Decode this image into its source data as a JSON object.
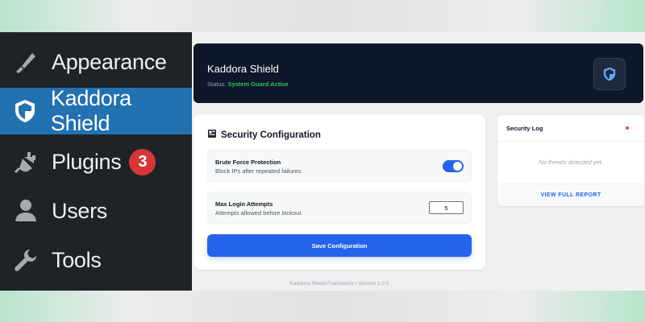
{
  "sidebar": {
    "items": [
      {
        "label": "Appearance",
        "icon": "paintbrush-icon"
      },
      {
        "label": "Kaddora Shield",
        "icon": "shield-icon",
        "active": true
      },
      {
        "label": "Plugins",
        "icon": "plug-icon",
        "badge": "3"
      },
      {
        "label": "Users",
        "icon": "user-icon"
      },
      {
        "label": "Tools",
        "icon": "wrench-icon"
      }
    ]
  },
  "header": {
    "title": "Kaddora Shield",
    "status_label": "Status:",
    "status_value": "System Guard Active",
    "icon": "shield-icon"
  },
  "config": {
    "title": "Security Configuration",
    "icon": "dashboard-icon",
    "brute_force": {
      "title": "Brute Force Protection",
      "subtitle": "Block IPs after repeated failures.",
      "enabled": true
    },
    "max_attempts": {
      "title": "Max Login Attempts",
      "subtitle": "Attempts allowed before lockout.",
      "value": "5"
    },
    "save_label": "Save Configuration"
  },
  "log": {
    "title": "Security Log",
    "empty_text": "No threats detected yet.",
    "link_label": "VIEW FULL REPORT"
  },
  "footer": {
    "text": "Kaddora Shield Framework • Version 1.0.0"
  },
  "colors": {
    "sidebar_bg": "#1d2327",
    "sidebar_active": "#2271b1",
    "badge": "#d63638",
    "header_bg": "#0f172a",
    "status_ok": "#22c55e",
    "accent": "#2563eb",
    "alert_dot": "#ef4444"
  }
}
